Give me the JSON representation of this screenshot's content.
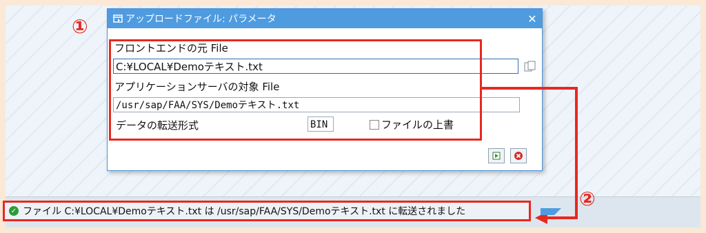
{
  "dialog": {
    "title": "アップロードファイル: パラメータ",
    "frontend_label": "フロントエンドの元 File",
    "frontend_value": "C:¥LOCAL¥Demoテキスト.txt",
    "appserver_label": "アプリケーションサーバの対象 File",
    "appserver_value": "/usr/sap/FAA/SYS/Demoテキスト.txt",
    "format_label": "データの転送形式",
    "format_value": "BIN",
    "overwrite_label": "ファイルの上書"
  },
  "annotations": {
    "marker_1": "①",
    "marker_2": "②"
  },
  "status": {
    "message": "ファイル C:¥LOCAL¥Demoテキスト.txt は /usr/sap/FAA/SYS/Demoテキスト.txt に転送されました"
  },
  "colors": {
    "annotation_red": "#e8281e",
    "title_blue": "#4f9be0",
    "success_green": "#2e9a3a"
  }
}
